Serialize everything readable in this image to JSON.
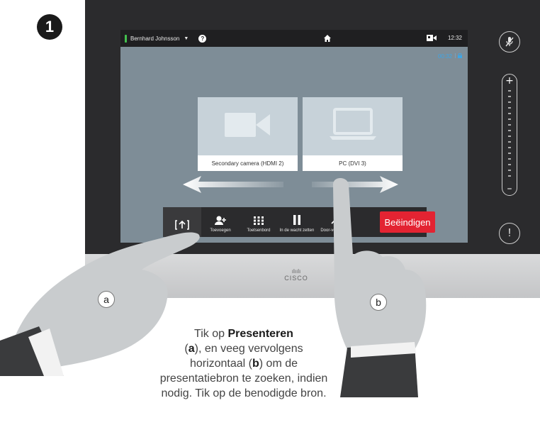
{
  "step": {
    "number": "1"
  },
  "status_bar": {
    "user_name": "Bernhard Johnsson",
    "clock": "12:32",
    "call_timer": "00:32"
  },
  "sources": [
    {
      "label": "Secondary camera (HDMI 2)",
      "icon": "video-camera-icon"
    },
    {
      "label": "PC (DVI 3)",
      "icon": "laptop-icon"
    }
  ],
  "call_bar": {
    "present_label": "",
    "add_label": "Toevoegen",
    "keypad_label": "Toetsenbord",
    "hold_label": "In de wacht zetten",
    "transfer_label": "Door-verbinden",
    "end_label": "Beëindigen"
  },
  "device": {
    "brand": "CISCO",
    "accent": "#3ea6e6",
    "end_color": "#e32332",
    "status_green": "#43c14e"
  },
  "hands": {
    "left_marker": "a",
    "right_marker": "b"
  },
  "caption": {
    "line_prefix": "Tik op ",
    "present_word": "Presenteren",
    "part2_open": "(",
    "a": "a",
    "part2_mid": "), en veeg vervolgens horizontaal (",
    "b": "b",
    "part3": ") om de presentatiebron te zoeken, indien nodig. Tik op de benodigde bron."
  }
}
